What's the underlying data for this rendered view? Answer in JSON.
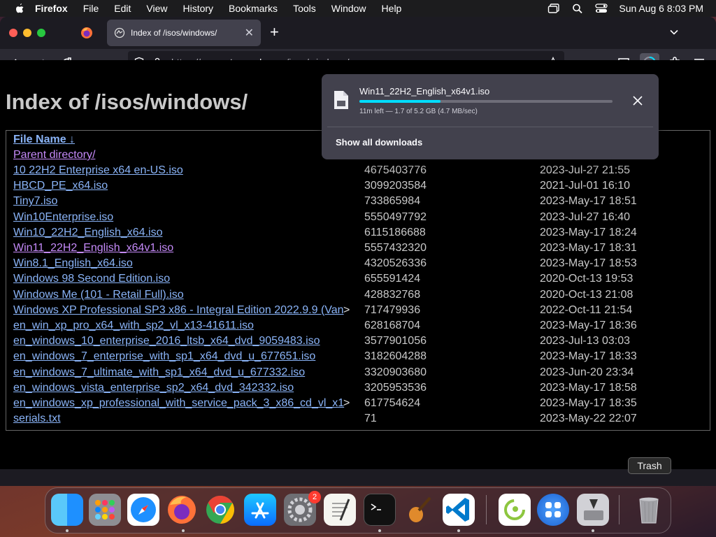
{
  "menubar": {
    "app": "Firefox",
    "items": [
      "File",
      "Edit",
      "View",
      "History",
      "Bookmarks",
      "Tools",
      "Window",
      "Help"
    ],
    "clock": "Sun Aug 6  8:03 PM"
  },
  "tab": {
    "title": "Index of /isos/windows/"
  },
  "urlbar": {
    "prefix": "https://",
    "host": "computernewb.com",
    "path": "/isos/windows/"
  },
  "page": {
    "title": "Index of /isos/windows/",
    "header_name": "File Name  ↓",
    "parent": "Parent directory/",
    "files": [
      {
        "name": "10 22H2 Enterprise x64 en-US.iso",
        "size": "4675403776",
        "date": "2023-Jul-27 21:55",
        "visited": false,
        "truncated": false
      },
      {
        "name": "HBCD_PE_x64.iso",
        "size": "3099203584",
        "date": "2021-Jul-01 16:10",
        "visited": false,
        "truncated": false
      },
      {
        "name": "Tiny7.iso",
        "size": "733865984",
        "date": "2023-May-17 18:51",
        "visited": false,
        "truncated": false
      },
      {
        "name": "Win10Enterprise.iso",
        "size": "5550497792",
        "date": "2023-Jul-27 16:40",
        "visited": false,
        "truncated": false
      },
      {
        "name": "Win10_22H2_English_x64.iso",
        "size": "6115186688",
        "date": "2023-May-17 18:24",
        "visited": false,
        "truncated": false
      },
      {
        "name": "Win11_22H2_English_x64v1.iso",
        "size": "5557432320",
        "date": "2023-May-17 18:31",
        "visited": true,
        "truncated": false
      },
      {
        "name": "Win8.1_English_x64.iso",
        "size": "4320526336",
        "date": "2023-May-17 18:53",
        "visited": false,
        "truncated": false
      },
      {
        "name": "Windows 98 Second Edition.iso",
        "size": "655591424",
        "date": "2020-Oct-13 19:53",
        "visited": false,
        "truncated": false
      },
      {
        "name": "Windows Me (101 - Retail Full).iso",
        "size": "428832768",
        "date": "2020-Oct-13 21:08",
        "visited": false,
        "truncated": false
      },
      {
        "name": "Windows XP Professional SP3 x86 - Integral Edition 2022.9.9 (Van",
        "size": "717479936",
        "date": "2022-Oct-11 21:54",
        "visited": false,
        "truncated": true
      },
      {
        "name": "en_win_xp_pro_x64_with_sp2_vl_x13-41611.iso",
        "size": "628168704",
        "date": "2023-May-17 18:36",
        "visited": false,
        "truncated": false
      },
      {
        "name": "en_windows_10_enterprise_2016_ltsb_x64_dvd_9059483.iso",
        "size": "3577901056",
        "date": "2023-Jul-13 03:03",
        "visited": false,
        "truncated": false
      },
      {
        "name": "en_windows_7_enterprise_with_sp1_x64_dvd_u_677651.iso",
        "size": "3182604288",
        "date": "2023-May-17 18:33",
        "visited": false,
        "truncated": false
      },
      {
        "name": "en_windows_7_ultimate_with_sp1_x64_dvd_u_677332.iso",
        "size": "3320903680",
        "date": "2023-Jun-20 23:34",
        "visited": false,
        "truncated": false
      },
      {
        "name": "en_windows_vista_enterprise_sp2_x64_dvd_342332.iso",
        "size": "3205953536",
        "date": "2023-May-17 18:58",
        "visited": false,
        "truncated": false
      },
      {
        "name": "en_windows_xp_professional_with_service_pack_3_x86_cd_vl_x1",
        "size": "617754624",
        "date": "2023-May-17 18:35",
        "visited": false,
        "truncated": true
      },
      {
        "name": "serials.txt",
        "size": "71",
        "date": "2023-May-22 22:07",
        "visited": false,
        "truncated": false
      }
    ],
    "truncation_marker": ">"
  },
  "download": {
    "filename": "Win11_22H2_English_x64v1.iso",
    "status": "11m left — 1.7 of 5.2 GB (4.7 MB/sec)",
    "progress": 0.32,
    "show_all": "Show all downloads"
  },
  "dock": {
    "tooltip": "Trash",
    "badge": "2"
  },
  "colors": {
    "link": "#8ab4f8",
    "visited": "#c58af9",
    "progress": "#00ddff"
  }
}
